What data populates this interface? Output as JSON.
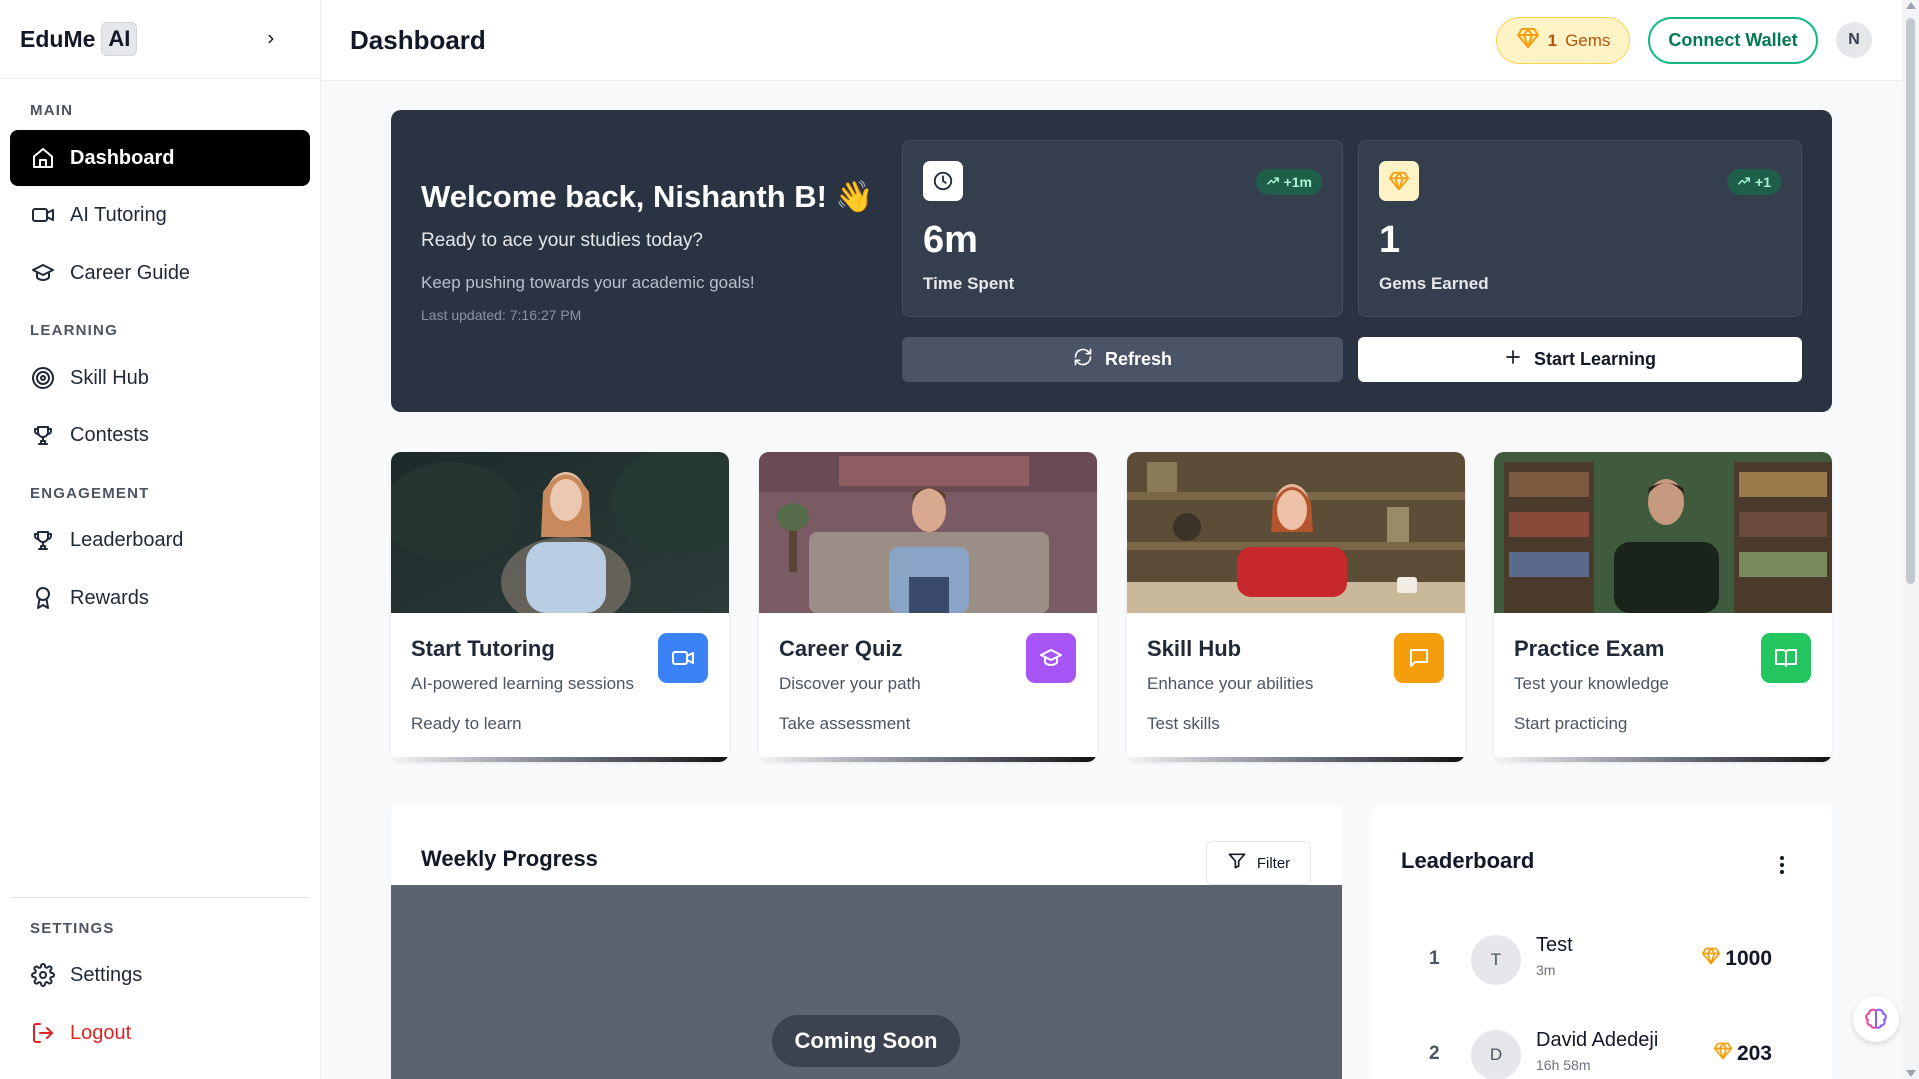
{
  "brand": {
    "name": "EduMe",
    "badge": "AI"
  },
  "sidebar": {
    "sections": {
      "main": "MAIN",
      "learning": "LEARNING",
      "engagement": "ENGAGEMENT",
      "settings": "SETTINGS"
    },
    "items": [
      {
        "label": "Dashboard",
        "icon": "home-icon",
        "active": true
      },
      {
        "label": "AI Tutoring",
        "icon": "video-icon"
      },
      {
        "label": "Career Guide",
        "icon": "graduation-cap-icon"
      },
      {
        "label": "Skill Hub",
        "icon": "target-icon"
      },
      {
        "label": "Contests",
        "icon": "trophy-icon"
      },
      {
        "label": "Leaderboard",
        "icon": "trophy-icon"
      },
      {
        "label": "Rewards",
        "icon": "award-icon"
      },
      {
        "label": "Settings",
        "icon": "gear-icon"
      },
      {
        "label": "Logout",
        "icon": "logout-icon"
      }
    ]
  },
  "header": {
    "title": "Dashboard",
    "gems_count": "1",
    "gems_label": "Gems",
    "wallet_button": "Connect Wallet",
    "avatar_initial": "N"
  },
  "hero": {
    "welcome": "Welcome back, Nishanth B!",
    "wave": "👋",
    "subtitle": "Ready to ace your studies today?",
    "motivation": "Keep pushing towards your academic goals!",
    "last_updated": "Last updated: 7:16:27 PM",
    "stats": [
      {
        "value": "6m",
        "label": "Time Spent",
        "badge": "+1m",
        "icon": "clock-icon"
      },
      {
        "value": "1",
        "label": "Gems Earned",
        "badge": "+1",
        "icon": "gem-icon"
      }
    ],
    "refresh_button": "Refresh",
    "start_button": "Start Learning"
  },
  "features": [
    {
      "title": "Start Tutoring",
      "desc": "AI-powered learning sessions",
      "cta": "Ready to learn",
      "icon": "video-icon",
      "color": "#3b82f6"
    },
    {
      "title": "Career Quiz",
      "desc": "Discover your path",
      "cta": "Take assessment",
      "icon": "graduation-cap-icon",
      "color": "#a855f7"
    },
    {
      "title": "Skill Hub",
      "desc": "Enhance your abilities",
      "cta": "Test skills",
      "icon": "message-icon",
      "color": "#f59e0b"
    },
    {
      "title": "Practice Exam",
      "desc": "Test your knowledge",
      "cta": "Start practicing",
      "icon": "book-icon",
      "color": "#22c55e"
    }
  ],
  "progress": {
    "title": "Weekly Progress",
    "filter": "Filter",
    "placeholder": "Coming Soon"
  },
  "leaderboard": {
    "title": "Leaderboard",
    "rows": [
      {
        "rank": "1",
        "initial": "T",
        "name": "Test",
        "time": "3m",
        "score": "1000"
      },
      {
        "rank": "2",
        "initial": "D",
        "name": "David Adedeji",
        "time": "16h 58m",
        "score": "203"
      }
    ]
  },
  "colors": {
    "accent": "#000000",
    "hero_bg": "#2a3342",
    "gem": "#f59e0b",
    "wallet": "#10b981",
    "logout": "#dc2626"
  }
}
